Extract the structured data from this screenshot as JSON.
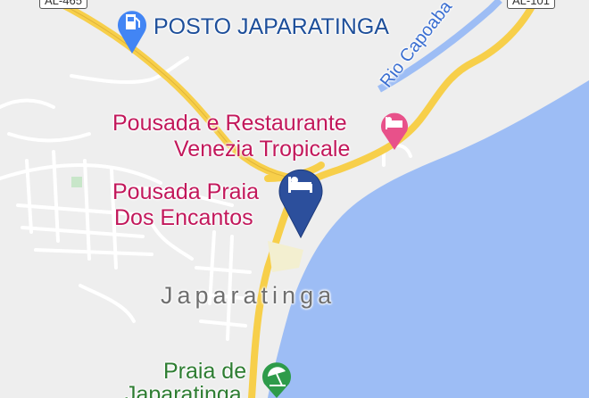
{
  "road_shields": {
    "al465": "AL-465",
    "al101": "AL-101"
  },
  "labels": {
    "gas_station": "POSTO JAPARATINGA",
    "river": "Rio Capoaba",
    "hotel_restaurant": [
      "Pousada e Restaurante",
      "Venezia Tropicale"
    ],
    "hotel_selected": [
      "Pousada Praia",
      "Dos Encantos"
    ],
    "town": "Japaratinga",
    "beach": [
      "Praia de",
      "Japaratinga"
    ]
  },
  "icons": {
    "gas_station": "fuel-pump-icon",
    "hotel": "bed-icon",
    "selected_marker": "map-pin-bed-icon",
    "beach": "beach-umbrella-icon"
  },
  "colors": {
    "land": "#eeeeee",
    "water": "#9dbdf5",
    "road_major": "#f7cf4a",
    "road_minor": "#ffffff",
    "poi_pink": "#c2185b",
    "marker": "#2c4f9c",
    "park_green": "#2e7d32"
  }
}
